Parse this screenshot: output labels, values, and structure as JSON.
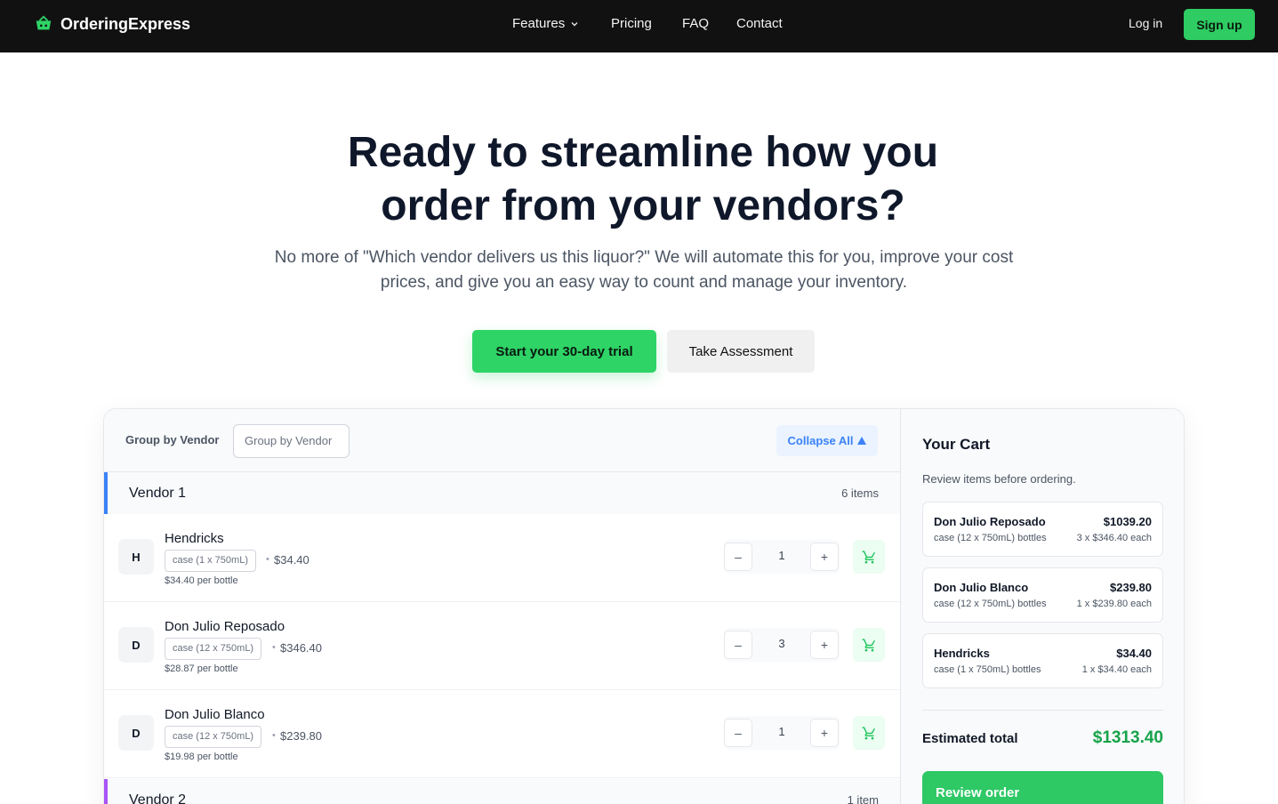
{
  "nav": {
    "brand": "OrderingExpress",
    "links": {
      "features": "Features",
      "pricing": "Pricing",
      "faq": "FAQ",
      "contact": "Contact"
    },
    "login": "Log in",
    "signup": "Sign up"
  },
  "hero": {
    "title_line1": "Ready to streamline how you",
    "title_line2": "order from your vendors?",
    "subtitle_line1": "No more of \"Which vendor delivers us this liquor?\" We will automate this for you, improve your cost",
    "subtitle_line2": "prices, and give you an easy way to count and manage your inventory.",
    "primary_cta": "Start your 30-day trial",
    "secondary_cta": "Take Assessment"
  },
  "toolbar": {
    "group_label": "Group by Vendor",
    "group_select_value": "Group by Vendor",
    "collapse_label": "Collapse All"
  },
  "vendors": [
    {
      "name": "Vendor 1",
      "count": "6 items",
      "items": [
        {
          "initial": "H",
          "name": "Hendricks",
          "unit": "case (1 x 750mL)",
          "price": "$34.40",
          "per_bottle": "$34.40 per bottle",
          "qty": "1"
        },
        {
          "initial": "D",
          "name": "Don Julio Reposado",
          "unit": "case (12 x 750mL)",
          "price": "$346.40",
          "per_bottle": "$28.87 per bottle",
          "qty": "3"
        },
        {
          "initial": "D",
          "name": "Don Julio Blanco",
          "unit": "case (12 x 750mL)",
          "price": "$239.80",
          "per_bottle": "$19.98 per bottle",
          "qty": "1"
        }
      ]
    },
    {
      "name": "Vendor 2",
      "count": "1 item"
    }
  ],
  "cart": {
    "title": "Your Cart",
    "subtitle": "Review items before ordering.",
    "items": [
      {
        "name": "Don Julio Reposado",
        "total": "$1039.20",
        "unit": "case (12 x 750mL) bottles",
        "each": "3 x $346.40 each"
      },
      {
        "name": "Don Julio Blanco",
        "total": "$239.80",
        "unit": "case (12 x 750mL) bottles",
        "each": "1 x $239.80 each"
      },
      {
        "name": "Hendricks",
        "total": "$34.40",
        "unit": "case (1 x 750mL) bottles",
        "each": "1 x $34.40 each"
      }
    ],
    "estimated_label": "Estimated total",
    "estimated_value": "$1313.40",
    "review_label": "Review order"
  },
  "icons": {
    "brand": "shopping-basket-icon",
    "chevron": "chevron-down-icon",
    "collapse": "triangle-up-icon",
    "add_to_cart": "cart-icon",
    "minus": "minus-icon",
    "plus": "plus-icon"
  },
  "colors": {
    "accent_green": "#2ed466",
    "vendor1_accent": "#3b82f6",
    "vendor2_accent": "#a855f7",
    "total_green": "#16a34a",
    "nav_bg": "#111111"
  },
  "symbols": {
    "minus": "–",
    "plus": "+",
    "bullet": "•"
  }
}
